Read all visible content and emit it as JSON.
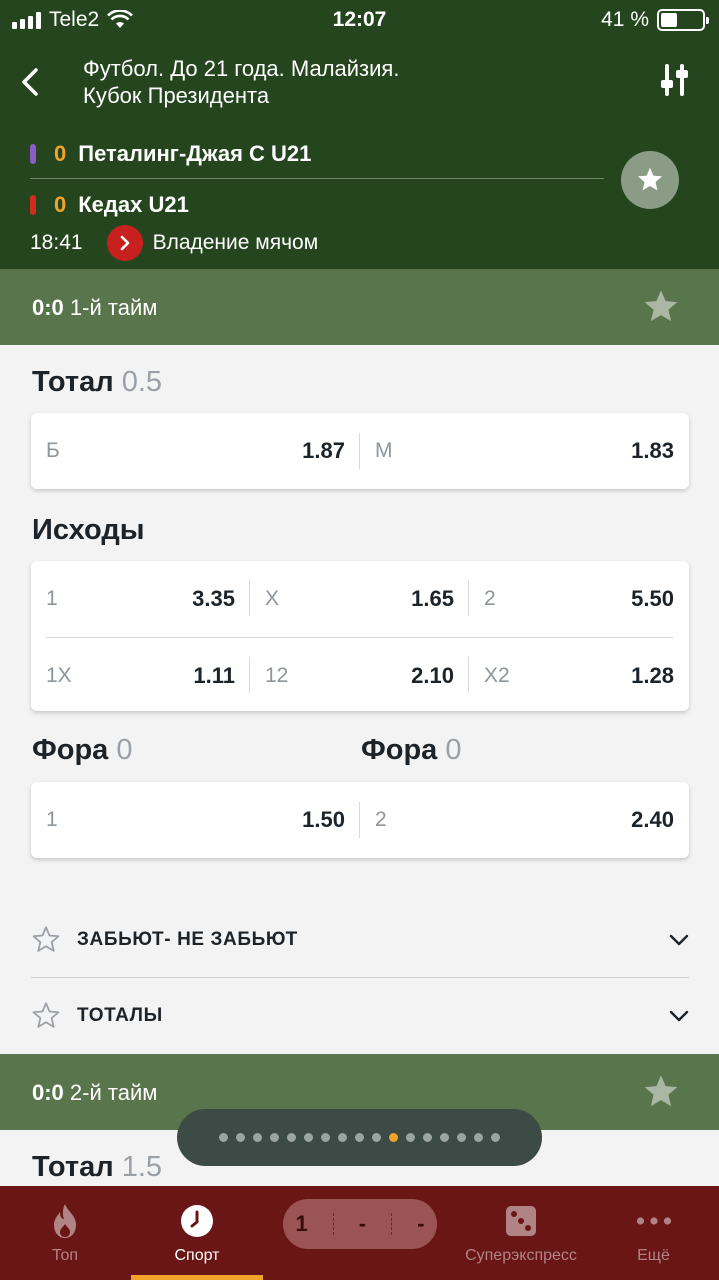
{
  "status": {
    "carrier": "Tele2",
    "time": "12:07",
    "battery": "41 %",
    "battery_level": 0.41
  },
  "header": {
    "title_line1": "Футбол. До 21 года. Малайзия.",
    "title_line2": "Кубок Президента"
  },
  "match": {
    "team1": {
      "score": "0",
      "name": "Петалинг-Джая С U21",
      "color": "#8b5cc8"
    },
    "team2": {
      "score": "0",
      "name": "Кедах U21",
      "color": "#d42b1e"
    },
    "time": "18:41",
    "event": "Владение мячом"
  },
  "period1": {
    "score": "0:0",
    "label": "1-й тайм"
  },
  "total": {
    "title": "Тотал",
    "param": "0.5",
    "odds": [
      {
        "label": "Б",
        "value": "1.87"
      },
      {
        "label": "М",
        "value": "1.83"
      }
    ]
  },
  "outcomes": {
    "title": "Исходы",
    "row1": [
      {
        "label": "1",
        "value": "3.35"
      },
      {
        "label": "X",
        "value": "1.65"
      },
      {
        "label": "2",
        "value": "5.50"
      }
    ],
    "row2": [
      {
        "label": "1X",
        "value": "1.11"
      },
      {
        "label": "12",
        "value": "2.10"
      },
      {
        "label": "X2",
        "value": "1.28"
      }
    ]
  },
  "handicap": {
    "title_left": "Фора",
    "param_left": "0",
    "title_right": "Фора",
    "param_right": "0",
    "odds": [
      {
        "label": "1",
        "value": "1.50"
      },
      {
        "label": "2",
        "value": "2.40"
      }
    ]
  },
  "collapsibles": [
    "ЗАБЬЮТ- НЕ ЗАБЬЮТ",
    "ТОТАЛЫ"
  ],
  "period2": {
    "score": "0:0",
    "label": "2-й тайм"
  },
  "total2": {
    "title": "Тотал",
    "param": "1.5"
  },
  "pager": {
    "count": 17,
    "active": 10
  },
  "coupon": {
    "slot1": "1",
    "slot2": "-",
    "slot3": "-"
  },
  "tabs": [
    {
      "label": "Топ",
      "icon": "fire-icon"
    },
    {
      "label": "Спорт",
      "icon": "clock-icon"
    },
    {
      "label": "Суперэкспресс",
      "icon": "dice-icon"
    },
    {
      "label": "Ещё",
      "icon": "more-icon"
    }
  ],
  "colors": {
    "header_bg": "#25451f",
    "period_bg": "#59754c",
    "accent": "#f2a32a",
    "tabbar_bg": "#6b1616"
  }
}
